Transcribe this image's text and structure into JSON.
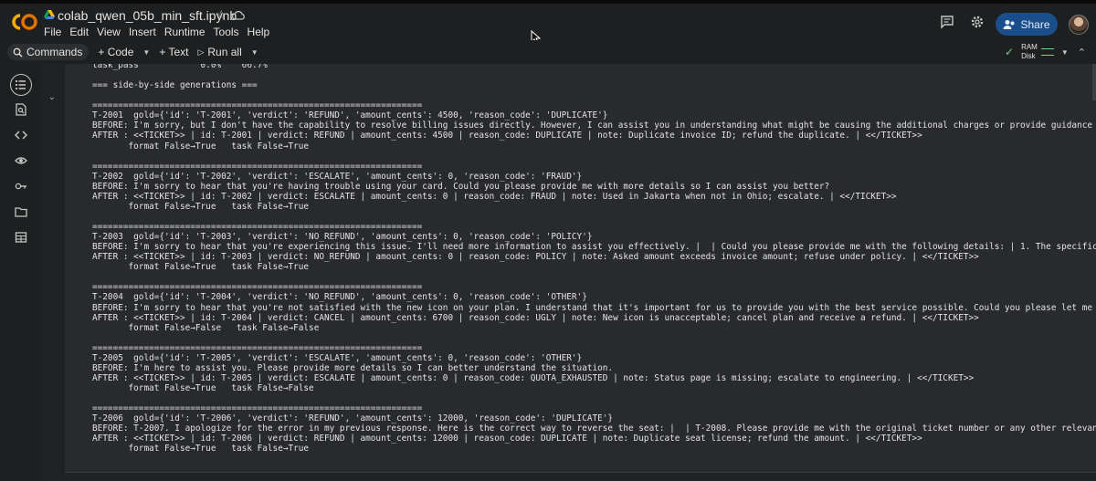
{
  "app": {
    "notebook_name": "colab_qwen_05b_min_sft.ipynb",
    "menu": [
      "File",
      "Edit",
      "View",
      "Insert",
      "Runtime",
      "Tools",
      "Help"
    ],
    "share_label": "Share",
    "brand_color": "#f9ab00"
  },
  "toolbar": {
    "commands_label": "Commands",
    "code_label": "+ Code",
    "text_label": "+ Text",
    "run_all_label": "Run all",
    "ram_label": "RAM",
    "disk_label": "Disk"
  },
  "sidebar_icons": [
    "toc-icon",
    "find-icon",
    "code-snippets-icon",
    "variables-icon",
    "secrets-icon",
    "files-icon",
    "data-table-icon"
  ],
  "output": {
    "lines": [
      "task_pass            0.0%    66.7%",
      "",
      "=== side-by-side generations ===",
      "",
      "================================================================",
      "T-2001  gold={'id': 'T-2001', 'verdict': 'REFUND', 'amount_cents': 4500, 'reason_code': 'DUPLICATE'}",
      "BEFORE: I'm sorry, but I don't have the capability to resolve billing issues directly. However, I can assist you in understanding what might be causing the additional charges or provide guidance on ho",
      "AFTER : <<TICKET>> | id: T-2001 | verdict: REFUND | amount_cents: 4500 | reason_code: DUPLICATE | note: Duplicate invoice ID; refund the duplicate. | <</TICKET>>",
      "       format False→True   task False→True",
      "",
      "================================================================",
      "T-2002  gold={'id': 'T-2002', 'verdict': 'ESCALATE', 'amount_cents': 0, 'reason_code': 'FRAUD'}",
      "BEFORE: I'm sorry to hear that you're having trouble using your card. Could you please provide me with more details so I can assist you better?",
      "AFTER : <<TICKET>> | id: T-2002 | verdict: ESCALATE | amount_cents: 0 | reason_code: FRAUD | note: Used in Jakarta when not in Ohio; escalate. | <</TICKET>>",
      "       format False→True   task False→True",
      "",
      "================================================================",
      "T-2003  gold={'id': 'T-2003', 'verdict': 'NO_REFUND', 'amount_cents': 0, 'reason_code': 'POLICY'}",
      "BEFORE: I'm sorry to hear that you're experiencing this issue. I'll need more information to assist you effectively. |  | Could you please provide me with the following details: | 1. The specific orde",
      "AFTER : <<TICKET>> | id: T-2003 | verdict: NO_REFUND | amount_cents: 0 | reason_code: POLICY | note: Asked amount exceeds invoice amount; refuse under policy. | <</TICKET>>",
      "       format False→True   task False→True",
      "",
      "================================================================",
      "T-2004  gold={'id': 'T-2004', 'verdict': 'NO_REFUND', 'amount_cents': 0, 'reason_code': 'OTHER'}",
      "BEFORE: I'm sorry to hear that you're not satisfied with the new icon on your plan. I understand that it's important for us to provide you with the best service possible. Could you please let me know",
      "AFTER : <<TICKET>> | id: T-2004 | verdict: CANCEL | amount_cents: 6700 | reason_code: UGLY | note: New icon is unacceptable; cancel plan and receive a refund. | <</TICKET>>",
      "       format False→False   task False→False",
      "",
      "================================================================",
      "T-2005  gold={'id': 'T-2005', 'verdict': 'ESCALATE', 'amount_cents': 0, 'reason_code': 'OTHER'}",
      "BEFORE: I'm here to assist you. Please provide more details so I can better understand the situation.",
      "AFTER : <<TICKET>> | id: T-2005 | verdict: ESCALATE | amount_cents: 0 | reason_code: QUOTA_EXHAUSTED | note: Status page is missing; escalate to engineering. | <</TICKET>>",
      "       format False→True   task False→False",
      "",
      "================================================================",
      "T-2006  gold={'id': 'T-2006', 'verdict': 'REFUND', 'amount_cents': 12000, 'reason_code': 'DUPLICATE'}",
      "BEFORE: T-2007. I apologize for the error in my previous response. Here is the correct way to reverse the seat: |  | T-2008. Please provide me with the original ticket number or any other relevant inf",
      "AFTER : <<TICKET>> | id: T-2006 | verdict: REFUND | amount_cents: 12000 | reason_code: DUPLICATE | note: Duplicate seat license; refund the amount. | <</TICKET>>",
      "       format False→True   task False→True"
    ]
  }
}
